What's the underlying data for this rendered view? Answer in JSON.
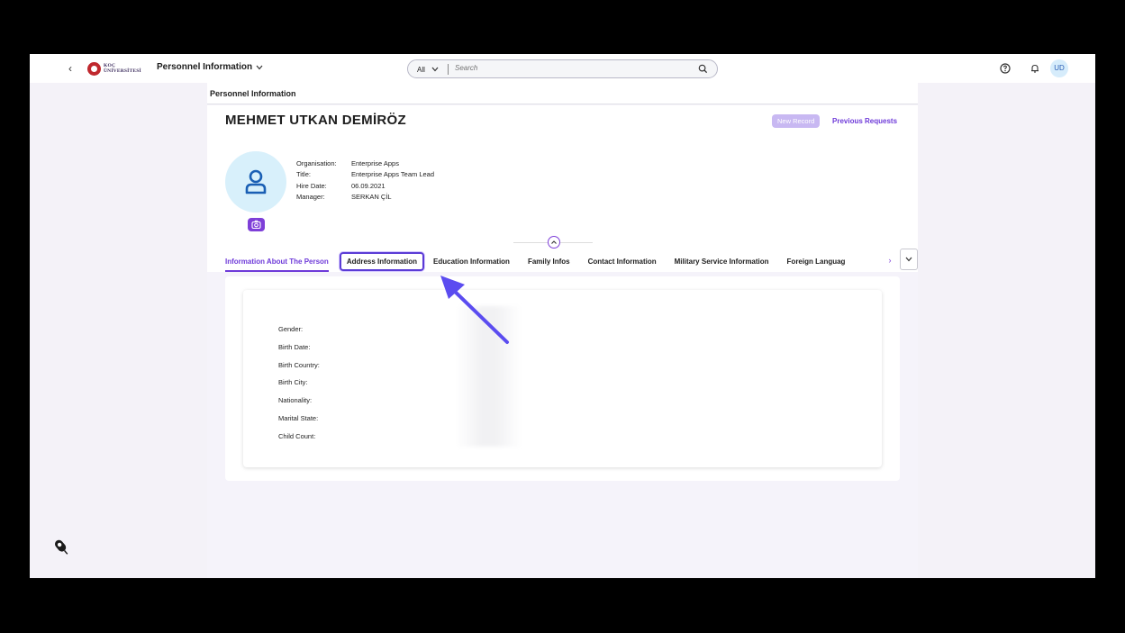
{
  "shell": {
    "logo_line1": "KOÇ",
    "logo_line2": "ÜNİVERSİTESİ",
    "app_title": "Personnel Information",
    "search_scope": "All",
    "search_placeholder": "Search",
    "user_initials": "UD"
  },
  "page": {
    "title": "Personnel Information",
    "employee_name": "MEHMET UTKAN DEMİRÖZ",
    "new_record_label": "New Record",
    "previous_requests_label": "Previous Requests"
  },
  "meta": {
    "organisation_label": "Organisation:",
    "organisation_value": "Enterprise Apps",
    "title_label": "Title:",
    "title_value": "Enterprise Apps Team Lead",
    "hire_date_label": "Hire Date:",
    "hire_date_value": "06.09.2021",
    "manager_label": "Manager:",
    "manager_value": "SERKAN ÇİL"
  },
  "tabs": [
    {
      "label": "Information About The Person"
    },
    {
      "label": "Address Information"
    },
    {
      "label": "Education Information"
    },
    {
      "label": "Family Infos"
    },
    {
      "label": "Contact Information"
    },
    {
      "label": "Military Service Information"
    },
    {
      "label": "Foreign Languag"
    }
  ],
  "fields": [
    {
      "label": "Gender:"
    },
    {
      "label": "Birth Date:"
    },
    {
      "label": "Birth Country:"
    },
    {
      "label": "Birth City:"
    },
    {
      "label": "Nationality:"
    },
    {
      "label": "Marital State:"
    },
    {
      "label": "Child Count:"
    }
  ],
  "colors": {
    "accent": "#6e3ad9",
    "arrow": "#5b4cf0"
  }
}
